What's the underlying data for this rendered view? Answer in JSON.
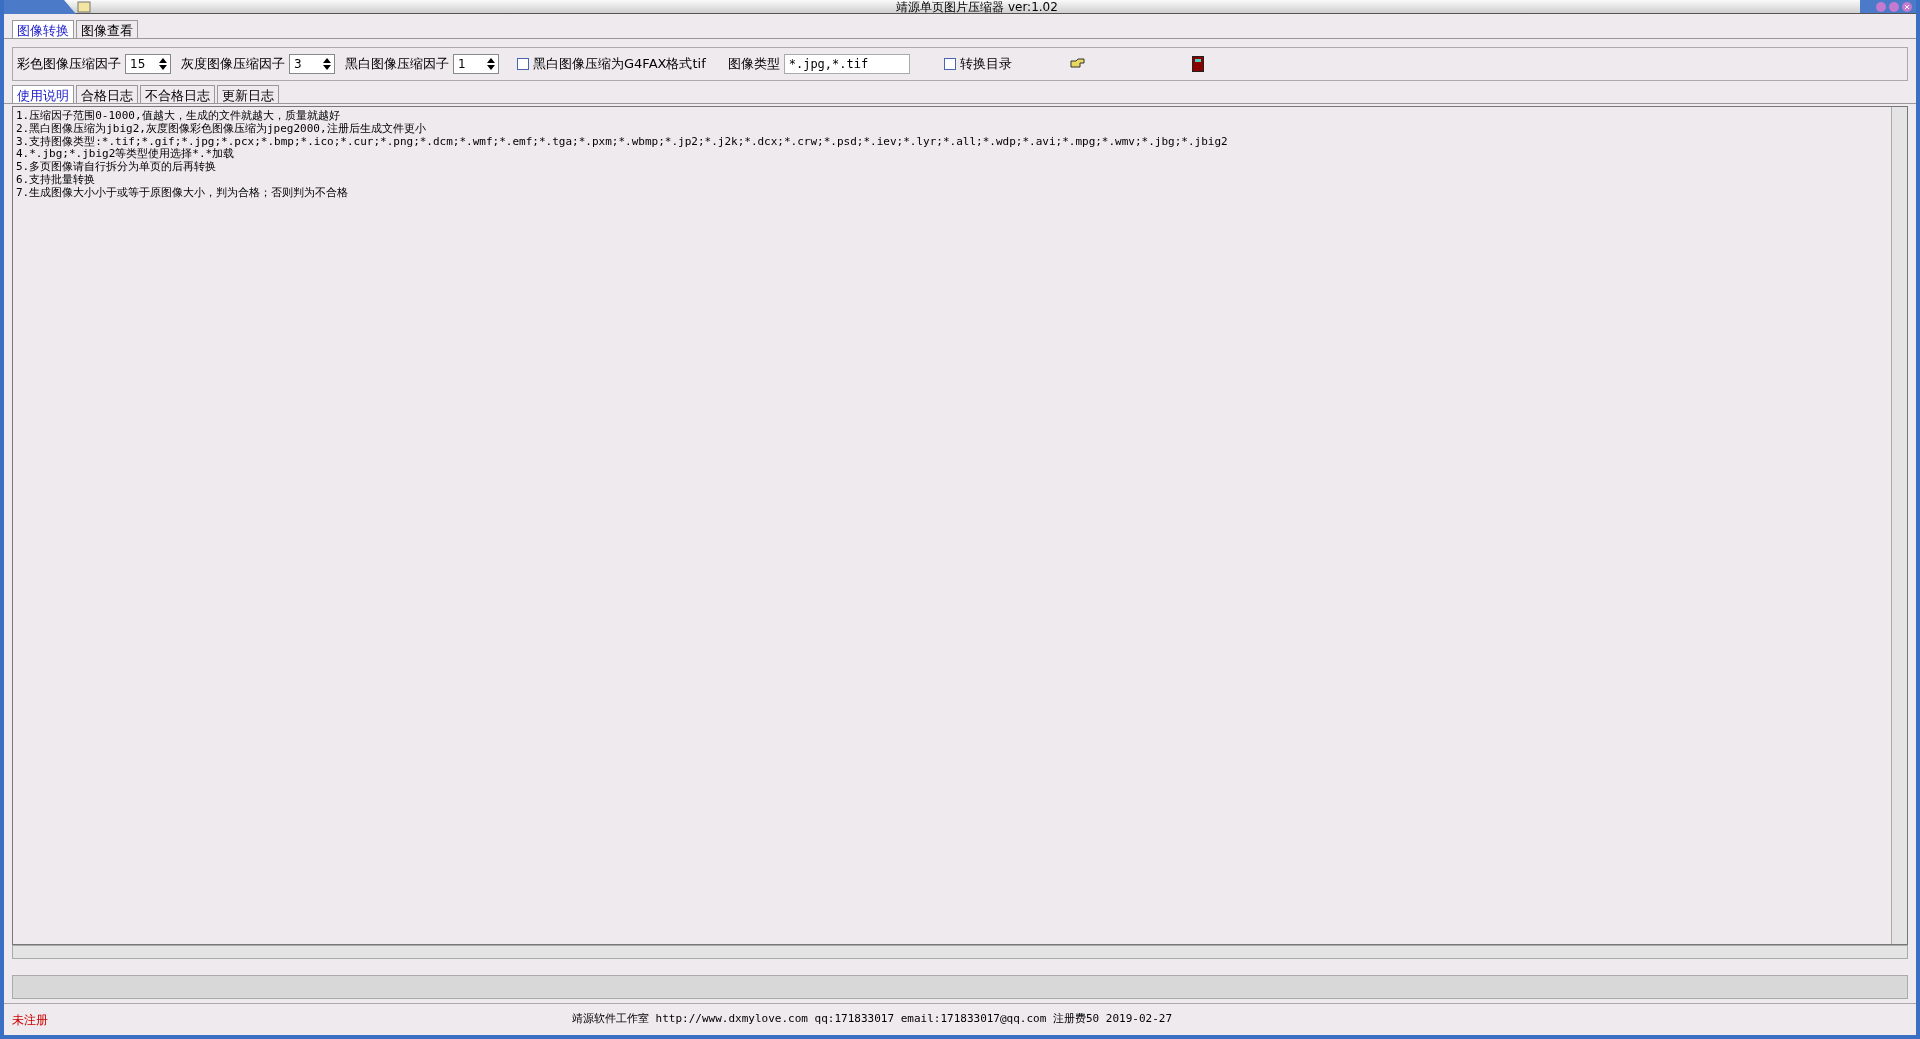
{
  "window": {
    "title": "靖源单页图片压缩器 ver:1.02"
  },
  "tabs": [
    {
      "label": "图像转换",
      "selected": true
    },
    {
      "label": "图像查看",
      "selected": false
    }
  ],
  "toolbar": {
    "color_factor": {
      "label": "彩色图像压缩因子",
      "value": "15"
    },
    "gray_factor": {
      "label": "灰度图像压缩因子",
      "value": "3"
    },
    "bw_factor": {
      "label": "黑白图像压缩因子",
      "value": "1"
    },
    "g4fax": {
      "label": "黑白图像压缩为G4FAX格式tif",
      "checked": false
    },
    "image_type": {
      "label": "图像类型",
      "value": "*.jpg,*.tif"
    },
    "convert_dir": {
      "label": "转换目录",
      "checked": false
    }
  },
  "log_tabs": [
    {
      "label": "使用说明",
      "selected": true
    },
    {
      "label": "合格日志",
      "selected": false
    },
    {
      "label": "不合格日志",
      "selected": false
    },
    {
      "label": "更新日志",
      "selected": false
    }
  ],
  "instructions": [
    "1.压缩因子范围0-1000,值越大，生成的文件就越大，质量就越好",
    "2.黑白图像压缩为jbig2,灰度图像彩色图像压缩为jpeg2000,注册后生成文件更小",
    "3.支持图像类型:*.tif;*.gif;*.jpg;*.pcx;*.bmp;*.ico;*.cur;*.png;*.dcm;*.wmf;*.emf;*.tga;*.pxm;*.wbmp;*.jp2;*.j2k;*.dcx;*.crw;*.psd;*.iev;*.lyr;*.all;*.wdp;*.avi;*.mpg;*.wmv;*.jbg;*.jbig2",
    "4.*.jbg;*.jbig2等类型使用选择*.*加载",
    "5.多页图像请自行拆分为单页的后再转换",
    "6.支持批量转换",
    "7.生成图像大小小于或等于原图像大小，判为合格；否则判为不合格"
  ],
  "status_bar": {
    "registration": "未注册",
    "info": "靖源软件工作室 http://www.dxmylove.com qq:171833017 email:171833017@qq.com 注册费50 2019-02-27"
  }
}
